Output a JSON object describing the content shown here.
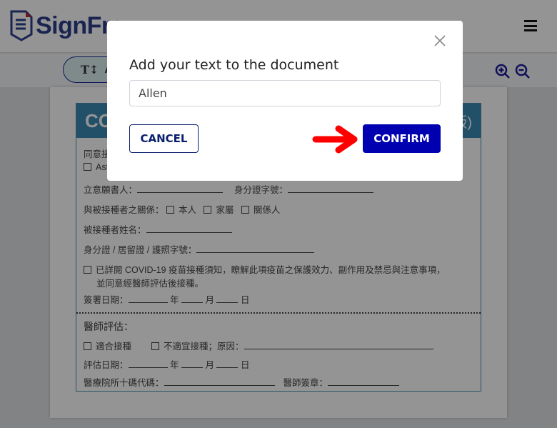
{
  "header": {
    "logo_text": "SignFre",
    "menu_icon": "hamburger-icon"
  },
  "toolbar": {
    "text_tool_label": "A",
    "icons": [
      "text-size-icon",
      "zoom-in-icon",
      "zoom-out-icon"
    ]
  },
  "document": {
    "title_left": "CO",
    "title_right": "版)",
    "line1": "同意接",
    "line2": "Ast",
    "signer": "立意願書人：",
    "id_no": "身分證字號：",
    "relation": "與被接種者之關係：",
    "rel_opts": [
      "本人",
      "家屬",
      "關係人"
    ],
    "name": "被接種者姓名：",
    "doc_no": "身分證 / 居留證 / 護照字號：",
    "consent1": "已詳閱 COVID-19 疫苗接種須知，瞭解此項疫苗之保護效力、副作用及禁忌與注意事項，",
    "consent2": "並同意經醫師評估後接種。",
    "sign_date": "簽署日期：",
    "year": "年",
    "month": "月",
    "day": "日",
    "doctor_eval": "醫師評估：",
    "suitable": "適合接種",
    "unsuitable": "不適宜接種；原因：",
    "eval_date": "評估日期：",
    "hospital_code": "醫療院所十碼代碼：",
    "doctor_sign": "醫師簽章："
  },
  "dialog": {
    "title": "Add your text to the document",
    "input_value": "Allen",
    "cancel_label": "CANCEL",
    "confirm_label": "CONFIRM"
  },
  "colors": {
    "confirm": "#0000b0",
    "cancel_border": "#0a1e6e",
    "arrow": "#ff0000",
    "doc_header": "#3a8ab3"
  }
}
